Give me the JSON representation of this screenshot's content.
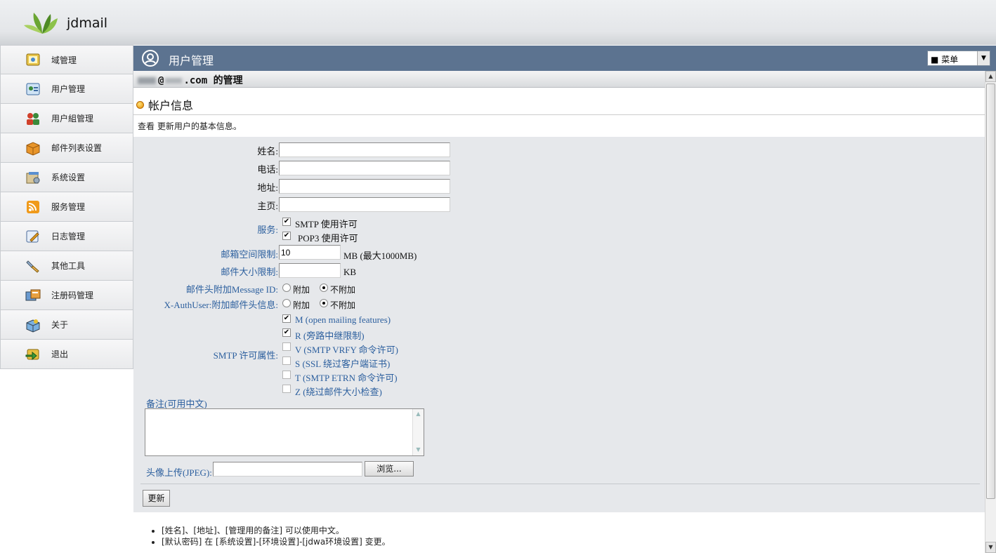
{
  "app": {
    "name": "jdmail"
  },
  "sidebar": {
    "items": [
      {
        "label": "域管理"
      },
      {
        "label": "用户管理"
      },
      {
        "label": "用户組管理"
      },
      {
        "label": "邮件列表设置"
      },
      {
        "label": "系统设置"
      },
      {
        "label": "服务管理"
      },
      {
        "label": "日志管理"
      },
      {
        "label": "其他工具"
      },
      {
        "label": "注册码管理"
      },
      {
        "label": "关于"
      },
      {
        "label": "退出"
      }
    ]
  },
  "header": {
    "title": "用户管理",
    "menu_value": "■ 菜单"
  },
  "subheader": {
    "email_suffix": "@",
    "domain_tail": ".com",
    "suffix": "的管理"
  },
  "section": {
    "title": "帐户信息",
    "desc": "查看 更新用户的基本信息。"
  },
  "form": {
    "name_label": "姓名:",
    "phone_label": "电话:",
    "address_label": "地址:",
    "homepage_label": "主页:",
    "service_label": "服务:",
    "smtp_perm": "SMTP 使用许可",
    "pop3_perm": "POP3 使用许可",
    "mailbox_limit_label": "邮箱空间限制:",
    "mailbox_limit_value": "10",
    "mailbox_limit_unit": "MB (最大1000MB)",
    "mail_size_label": "邮件大小限制:",
    "mail_size_value": "",
    "mail_size_unit": "KB",
    "msgid_label": "邮件头附加Message ID:",
    "authuser_label": "X-AuthUser:附加邮件头信息:",
    "radio_attach": "附加",
    "radio_noattach": "不附加",
    "smtp_attr_label": "SMTP 许可属性:",
    "smtp_attrs": [
      {
        "label": "M (open mailing features)",
        "checked": true
      },
      {
        "label": "R (旁路中继限制)",
        "checked": true
      },
      {
        "label": "V (SMTP VRFY 命令许可)",
        "checked": false
      },
      {
        "label": "S (SSL 绕过客户端证书)",
        "checked": false
      },
      {
        "label": "T (SMTP ETRN 命令许可)",
        "checked": false
      },
      {
        "label": "Z (绕过邮件大小检查)",
        "checked": false
      }
    ],
    "note_label": "备注(可用中文)",
    "avatar_label": "头像上传(JPEG):",
    "browse_button": "浏览...",
    "update_button": "更新"
  },
  "notes": [
    "[姓名]、[地址]、[管理用的备注] 可以使用中文。",
    "[默认密码] 在 [系统设置]-[环境设置]-[jdwa环境设置] 变更。"
  ],
  "colors": {
    "titlebar": "#5c7390",
    "link_blue": "#2c5f9e"
  }
}
